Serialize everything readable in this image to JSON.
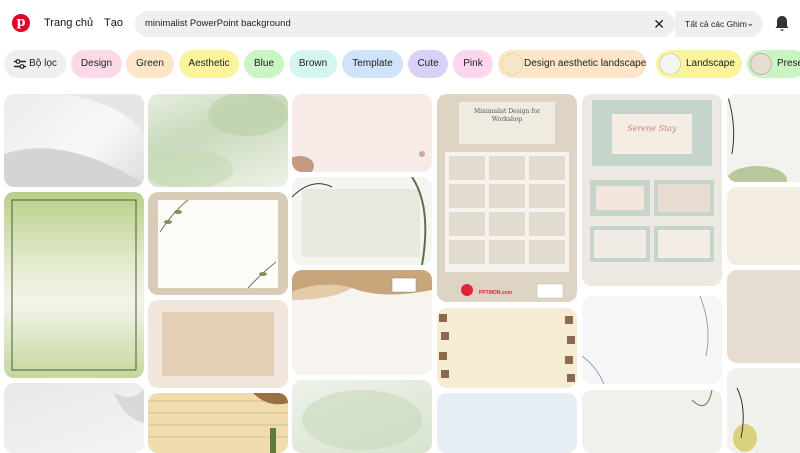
{
  "header": {
    "logo_letter": "p",
    "home_label": "Trang chủ",
    "create_label": "Tạo",
    "search_query": "minimalist PowerPoint background",
    "scope_label": "Tất cả các Ghim"
  },
  "filter_chip": {
    "label": "Bộ lọc"
  },
  "chips": [
    {
      "label": "Design",
      "bg": "#fbd9e6"
    },
    {
      "label": "Green",
      "bg": "#fde6c8"
    },
    {
      "label": "Aesthetic",
      "bg": "#fbf49b"
    },
    {
      "label": "Blue",
      "bg": "#c9f5c2"
    },
    {
      "label": "Brown",
      "bg": "#d5f5f1"
    },
    {
      "label": "Template",
      "bg": "#cfe3fa"
    },
    {
      "label": "Cute",
      "bg": "#d9d1f7"
    },
    {
      "label": "Pink",
      "bg": "#fbd6ec"
    },
    {
      "label": "Design aesthetic landscape",
      "bg": "#fde6c8"
    },
    {
      "label": "Landscape",
      "bg": "#fbf49b"
    },
    {
      "label": "Prese",
      "bg": "#c9f5c2"
    }
  ],
  "pin_texts": {
    "workshop_title": "Minimalist Design for Workshop",
    "serenity_title": "Serene Stay",
    "watermark": "PPTMON.com"
  },
  "colors": {
    "brand": "#e60023",
    "search_bg": "#efefef"
  }
}
